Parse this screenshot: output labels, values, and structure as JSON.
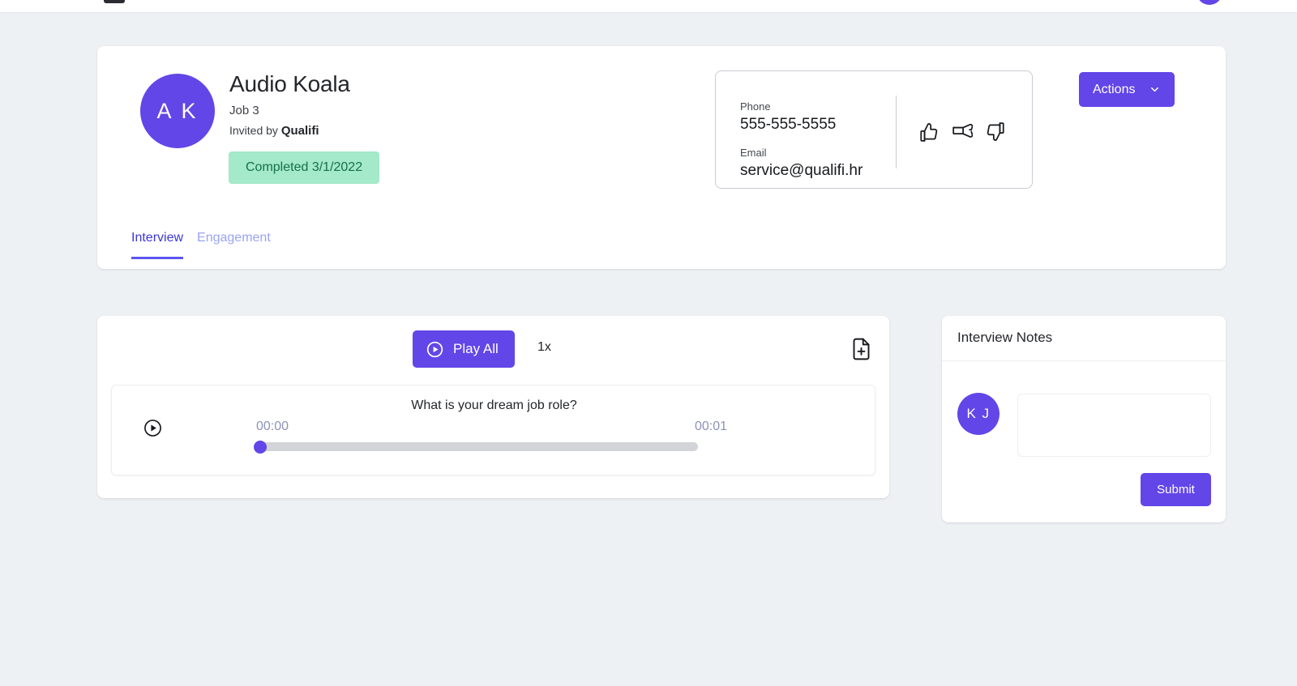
{
  "topbar": {
    "logo_icon": "app-logo",
    "avatar_icon": "user-avatar"
  },
  "candidate": {
    "initials": "A K",
    "name": "Audio Koala",
    "job": "Job 3",
    "invited_by_prefix": "Invited by ",
    "invited_by": "Qualifi",
    "status": "Completed 3/1/2022",
    "status_bg": "#a4e9c9",
    "status_fg": "#157047"
  },
  "contact": {
    "phone_label": "Phone",
    "phone_value": "555-555-5555",
    "email_label": "Email",
    "email_value": "service@qualifi.hr",
    "rating_icons": [
      "thumbs-up-icon",
      "thumbs-sideways-icon",
      "thumbs-down-icon"
    ]
  },
  "actions": {
    "label": "Actions",
    "chevron_icon": "chevron-down-icon"
  },
  "tabs": [
    {
      "label": "Interview",
      "active": true
    },
    {
      "label": "Engagement",
      "active": false
    }
  ],
  "player": {
    "play_all_label": "Play All",
    "play_all_icon": "play-circle-icon",
    "speed": "1x",
    "document_add_icon": "document-add-icon",
    "question": {
      "play_icon": "play-circle-icon",
      "text": "What is your dream job role?",
      "time_current": "00:00",
      "time_total": "00:01",
      "progress_percent": 0
    }
  },
  "notes": {
    "title": "Interview Notes",
    "author_initials": "K J",
    "textarea_value": "",
    "textarea_placeholder": "",
    "submit_label": "Submit"
  },
  "theme": {
    "primary": "#6246e8",
    "page_bg": "#eef1f4",
    "card_bg": "#ffffff",
    "tab_active": "#3b36d8",
    "tab_inactive": "#9aa4f4"
  }
}
